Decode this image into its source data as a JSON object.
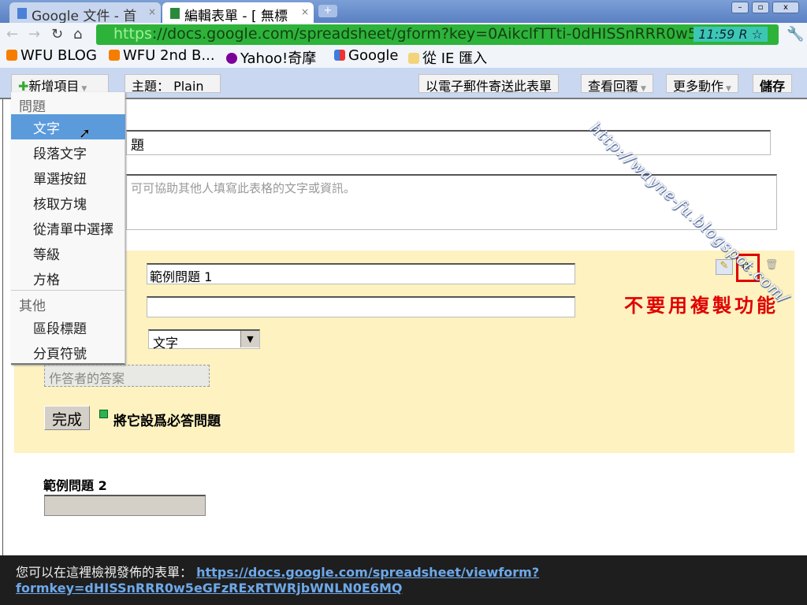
{
  "browser": {
    "tabs": [
      {
        "label": "Google 文件 - 首",
        "active": false
      },
      {
        "label": "編輯表單 - [ 無標",
        "active": true
      }
    ],
    "url_scheme": "https",
    "url_rest": "://docs.google.com/spreadsheet/gform?key=0AikclfTTti-0dHISSnRRR0w5e",
    "url_tail": "R",
    "clock": "11:59",
    "bookmarks": [
      {
        "label": "WFU BLOG",
        "icon": "blogger-icon"
      },
      {
        "label": "WFU 2nd B...",
        "icon": "blogger-icon"
      },
      {
        "label": "Yahoo!奇摩",
        "icon": "yahoo-icon"
      },
      {
        "label": "Google",
        "icon": "google-icon"
      },
      {
        "label": "從 IE 匯入",
        "icon": "folder-icon"
      }
    ]
  },
  "toolbar": {
    "add_item": "新增項目",
    "theme": "主題：  Plain",
    "email": "以電子郵件寄送此表單",
    "responses": "查看回覆",
    "more": "更多動作",
    "save": "儲存"
  },
  "menu": {
    "section1": "問題",
    "items1": [
      "文字",
      "段落文字",
      "單選按鈕",
      "核取方塊",
      "從清單中選擇",
      "等級",
      "方格"
    ],
    "section2": "其他",
    "items2": [
      "區段標題",
      "分頁符號"
    ]
  },
  "form": {
    "title_partial": "題",
    "description_placeholder": "可可協助其他人填寫此表格的文字或資訊。",
    "q1_title": "範例問題 1",
    "q1_help": "",
    "q1_type": "文字",
    "answer_placeholder": "作答者的答案",
    "done": "完成",
    "required": "將它設爲必答問題",
    "q2_title": "範例問題 2",
    "annotation": "不要用複製功能"
  },
  "footer": {
    "text": "您可以在這裡檢視發佈的表單：",
    "link1": "https://docs.google.com/spreadsheet/viewform?",
    "link2": "formkey=dHISSnRRR0w5eGFzRExRTWRjbWNLN0E6MQ"
  },
  "watermark": "http://wayne-fu.blogspot.com/",
  "colors": {
    "selection": "#5b9bdc",
    "question_bg": "#fdf2c0",
    "annotation": "#e00000",
    "footer_bg": "#1e1e1e"
  }
}
